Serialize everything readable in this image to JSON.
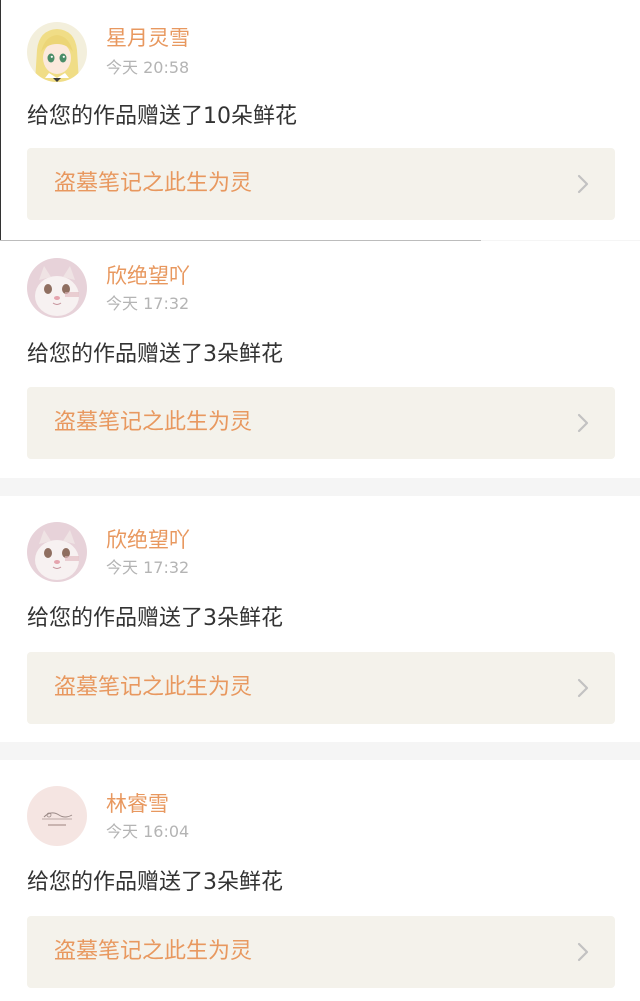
{
  "notifications": [
    {
      "user": "星月灵雪",
      "avatar_icon": "anime-girl-avatar",
      "time": "今天 20:58",
      "message": "给您的作品赠送了10朵鲜花",
      "work_title": "盗墓笔记之此生为灵"
    },
    {
      "user": "欣绝望吖",
      "avatar_icon": "cat-avatar",
      "time": "今天 17:32",
      "message": "给您的作品赠送了3朵鲜花",
      "work_title": "盗墓笔记之此生为灵"
    },
    {
      "user": "欣绝望吖",
      "avatar_icon": "cat-avatar",
      "time": "今天 17:32",
      "message": "给您的作品赠送了3朵鲜花",
      "work_title": "盗墓笔记之此生为灵"
    },
    {
      "user": "林睿雪",
      "avatar_icon": "sketch-avatar",
      "time": "今天 16:04",
      "message": "给您的作品赠送了3朵鲜花",
      "work_title": "盗墓笔记之此生为灵"
    }
  ],
  "colors": {
    "accent": "#e8985f",
    "card_link_bg": "#f4f2eb",
    "separator": "#f5f5f5",
    "time": "#b4b4b4",
    "text": "#333333"
  }
}
